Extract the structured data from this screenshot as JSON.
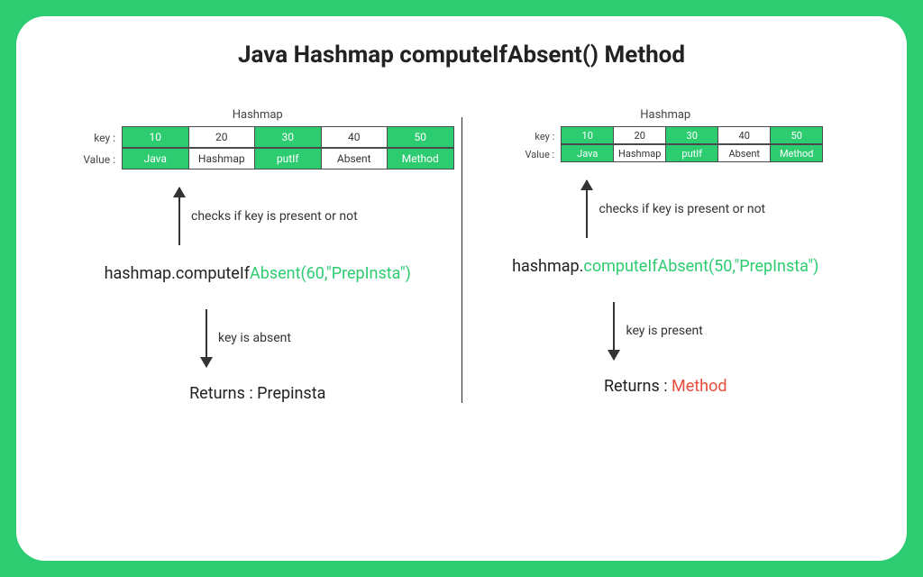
{
  "title": "Java Hashmap computeIfAbsent() Method",
  "table_caption": "Hashmap",
  "row_labels": {
    "key": "key :",
    "value": "Value :"
  },
  "keys": [
    "10",
    "20",
    "30",
    "40",
    "50"
  ],
  "values": [
    "Java",
    "Hashmap",
    "putIf",
    "Absent",
    "Method"
  ],
  "cell_green": [
    true,
    false,
    true,
    false,
    true
  ],
  "left": {
    "check_text": "checks if key is present or not",
    "code_prefix": "hashmap.computeIf",
    "code_hl": "Absent(60,\"PrepInsta\")",
    "result_text": "key is absent",
    "returns_label": "Returns : ",
    "returns_value": "Prepinsta",
    "returns_red": false
  },
  "right": {
    "check_text": "checks if key is present or not",
    "code_prefix": "hashmap.",
    "code_hl": "computeIfAbsent(50,\"PrepInsta\")",
    "result_text": "key is present",
    "returns_label": "Returns : ",
    "returns_value": "Method",
    "returns_red": true
  }
}
